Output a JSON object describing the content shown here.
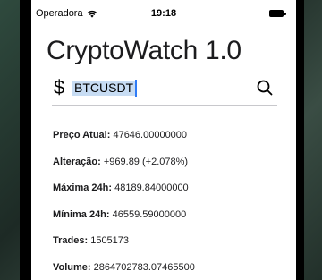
{
  "status_bar": {
    "carrier": "Operadora",
    "time": "19:18",
    "wifi_icon": "wifi-icon",
    "battery_icon": "battery-icon"
  },
  "app": {
    "title": "CryptoWatch 1.0"
  },
  "search": {
    "currency_symbol": "$",
    "value": "BTCUSDT",
    "search_icon": "magnifying-glass-icon"
  },
  "stats": [
    {
      "label": "Preço Atual:",
      "value": "47646.00000000"
    },
    {
      "label": "Alteração:",
      "value": "+969.89 (+2.078%)"
    },
    {
      "label": "Máxima 24h:",
      "value": "48189.84000000"
    },
    {
      "label": "Mínima 24h:",
      "value": "46559.59000000"
    },
    {
      "label": "Trades:",
      "value": "1505173"
    },
    {
      "label": "Volume:",
      "value": "2864702783.07465500"
    }
  ],
  "colors": {
    "selection": "#c7dcf3",
    "caret": "#2f7cf6",
    "divider": "#c8c8cc"
  }
}
